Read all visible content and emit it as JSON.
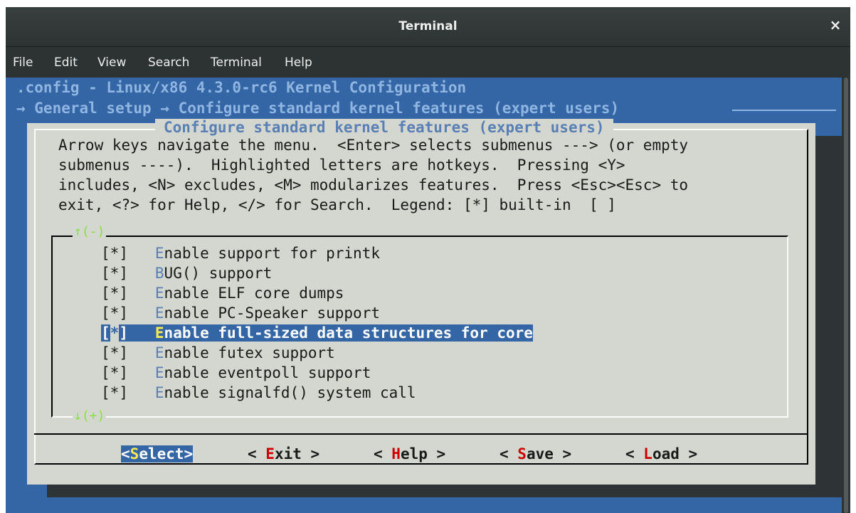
{
  "window": {
    "title": "Terminal",
    "close_glyph": "×"
  },
  "menubar": {
    "items": [
      "File",
      "Edit",
      "View",
      "Search",
      "Terminal",
      "Help"
    ]
  },
  "header": {
    "line1": ".config - Linux/x86 4.3.0-rc6 Kernel Configuration",
    "line2": "→ General setup → Configure standard kernel features (expert users)"
  },
  "dialog": {
    "title": "Configure standard kernel features (expert users)",
    "help_lines": [
      "Arrow keys navigate the menu.  <Enter> selects submenus ---> (or empty",
      "submenus ----).  Highlighted letters are hotkeys.  Pressing <Y>",
      "includes, <N> excludes, <M> modularizes features.  Press <Esc><Esc> to",
      "exit, <?> for Help, </> for Search.  Legend: [*] built-in  [ ]"
    ],
    "scroll_up": "↑(-)",
    "scroll_down": "↓(+)",
    "items": [
      {
        "state": "*",
        "hotkey": "E",
        "rest": "nable support for printk"
      },
      {
        "state": "*",
        "hotkey": "B",
        "rest": "UG() support"
      },
      {
        "state": "*",
        "hotkey": "E",
        "rest": "nable ELF core dumps"
      },
      {
        "state": "*",
        "hotkey": "E",
        "rest": "nable PC-Speaker support"
      },
      {
        "state": "*",
        "hotkey": "E",
        "rest": "nable full-sized data structures for core"
      },
      {
        "state": "*",
        "hotkey": "E",
        "rest": "nable futex support"
      },
      {
        "state": "*",
        "hotkey": "E",
        "rest": "nable eventpoll support"
      },
      {
        "state": "*",
        "hotkey": "E",
        "rest": "nable signalfd() system call"
      }
    ],
    "selected_index": 4,
    "buttons": {
      "select": {
        "pre": "<",
        "hot": "S",
        "post": "elect>"
      },
      "exit": {
        "pre": "< ",
        "hot": "E",
        "post": "xit >"
      },
      "help": {
        "pre": "< ",
        "hot": "H",
        "post": "elp >"
      },
      "save": {
        "pre": "< ",
        "hot": "S",
        "post": "ave >"
      },
      "load": {
        "pre": "< ",
        "hot": "L",
        "post": "oad >"
      }
    }
  },
  "colors": {
    "terminal_bg": "#3465a4",
    "dialog_bg": "#d3d7cf",
    "hotkey_blue": "#5a7fb4",
    "hotkey_red": "#cc0000",
    "hotkey_selected": "#fce94f",
    "scroll_arrows": "#8ae234"
  }
}
